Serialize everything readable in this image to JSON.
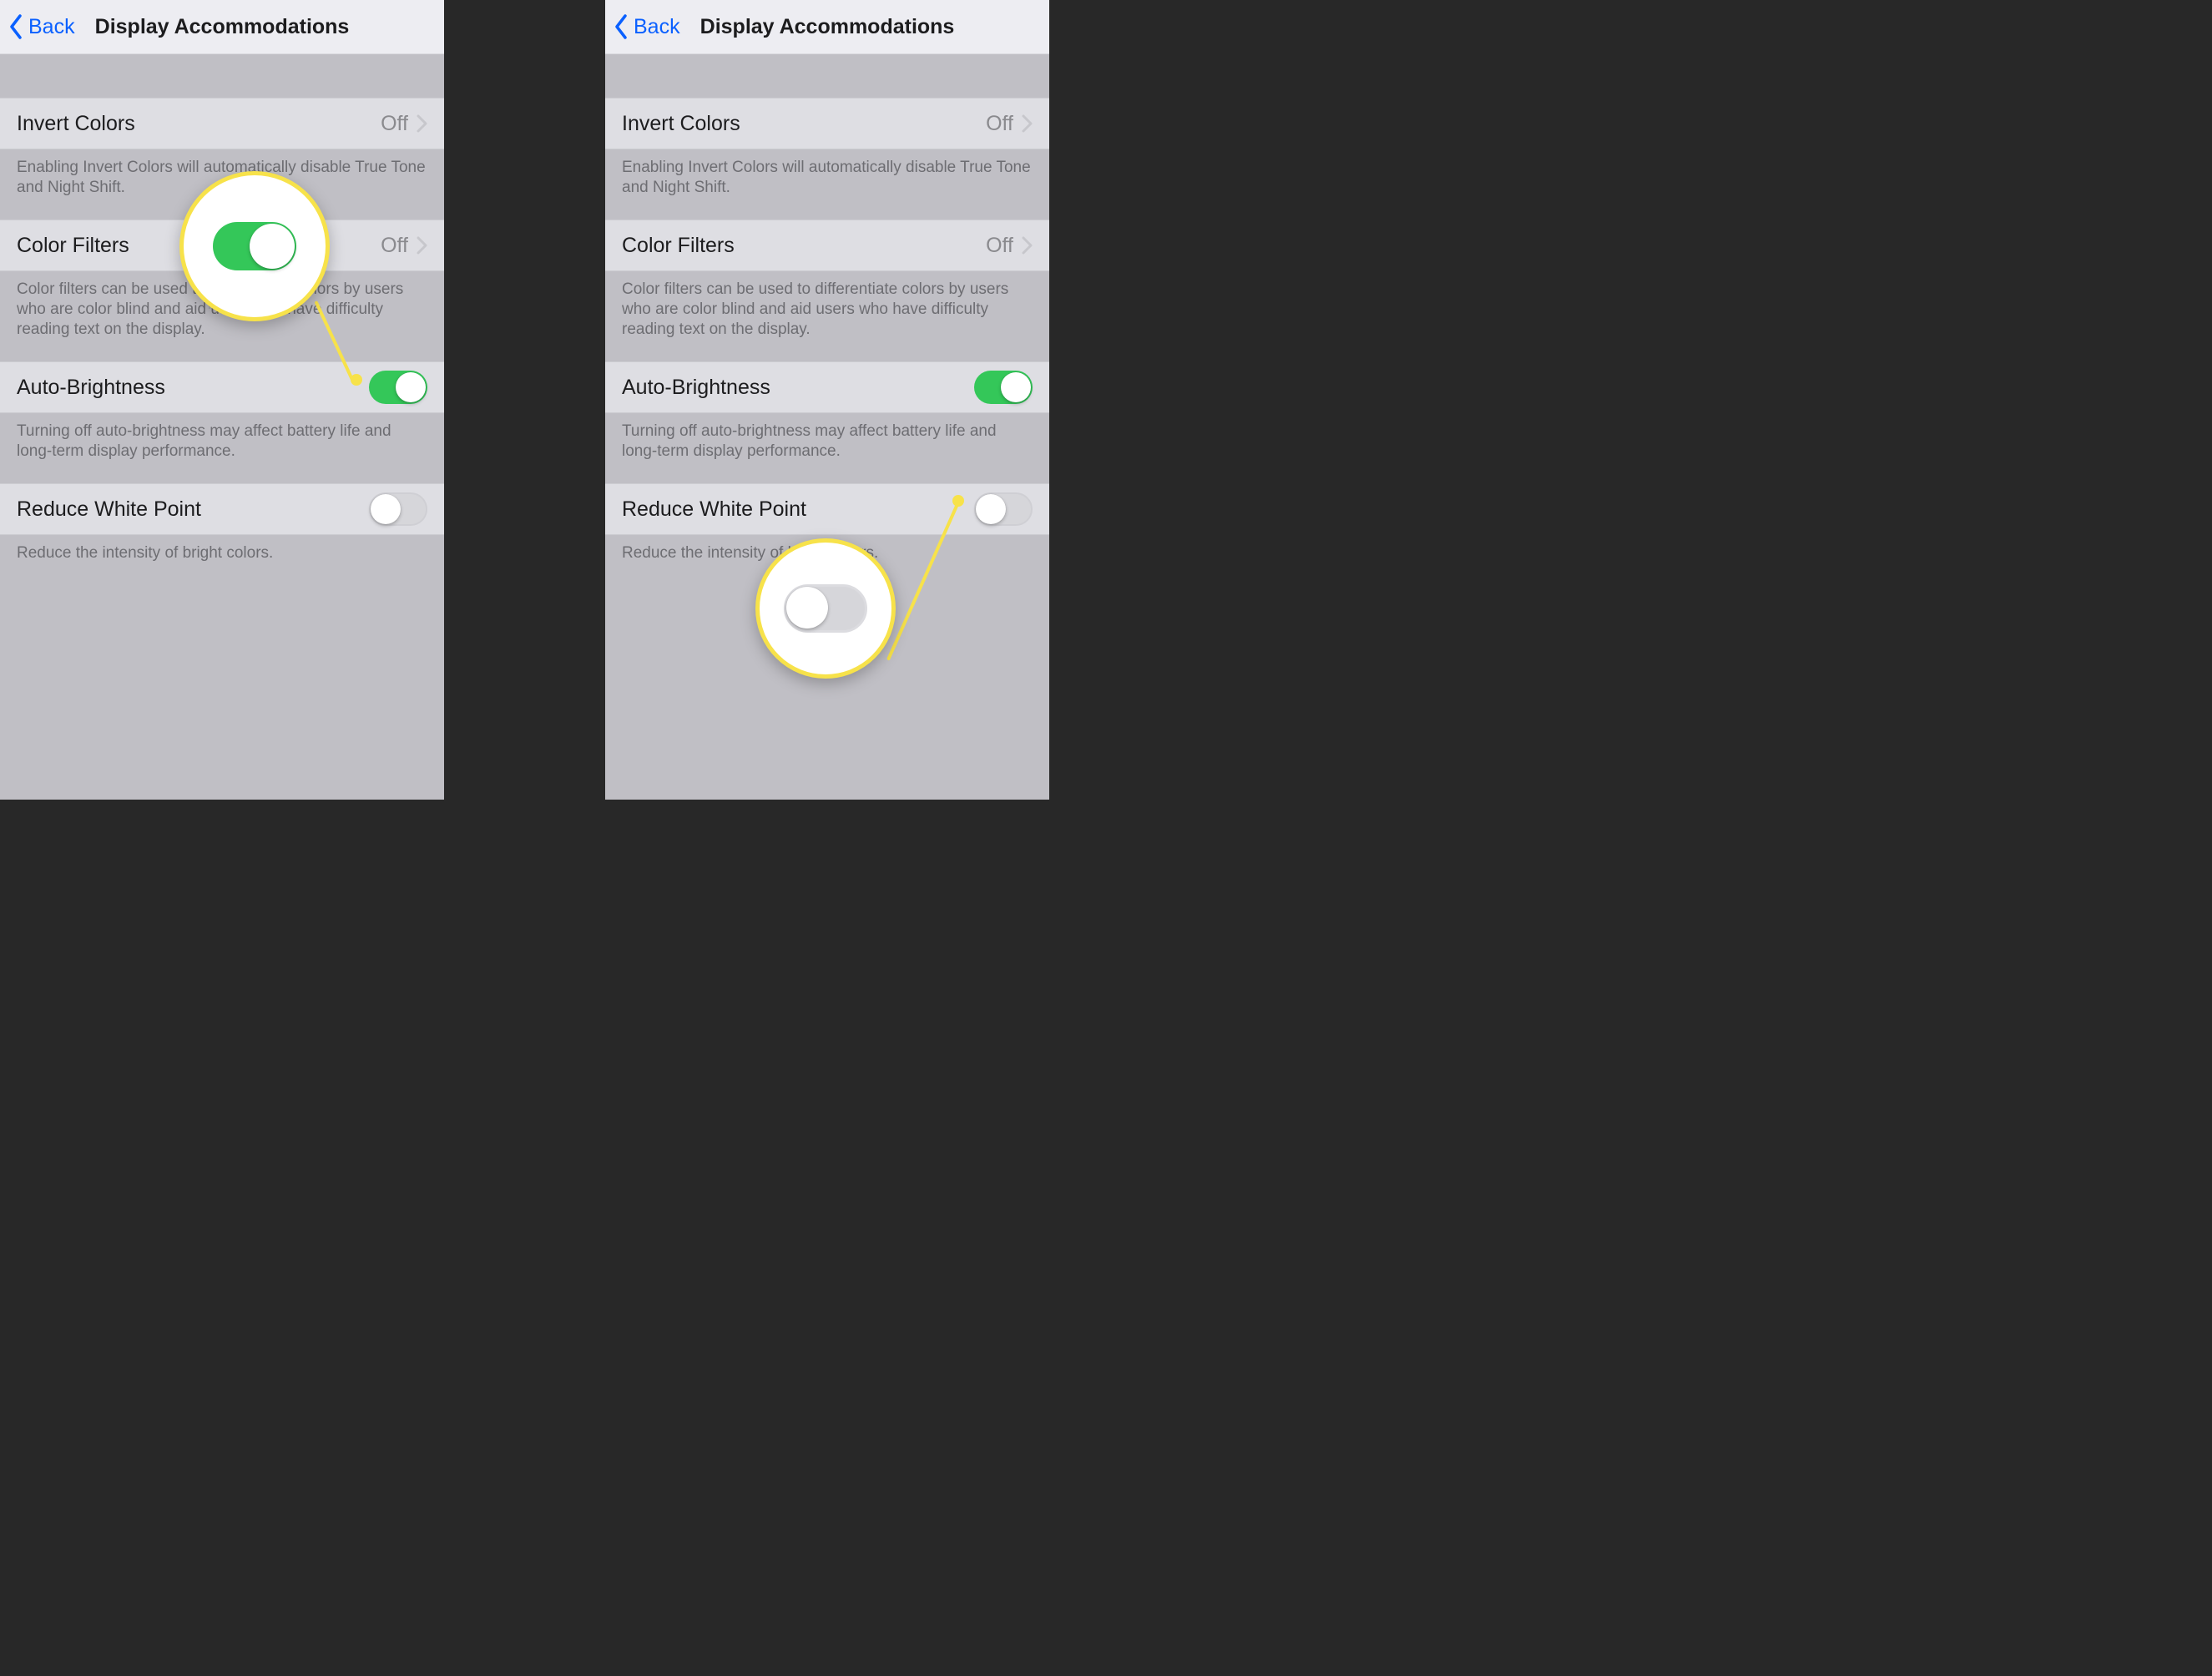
{
  "nav": {
    "back": "Back",
    "title": "Display Accommodations"
  },
  "invert": {
    "label": "Invert Colors",
    "value": "Off",
    "footer": "Enabling Invert Colors will automatically disable True Tone and Night Shift."
  },
  "filters": {
    "label": "Color Filters",
    "value": "Off",
    "footer": "Color filters can be used to differentiate colors by users who are color blind and aid users who have difficulty reading text on the display."
  },
  "autobrightness": {
    "label": "Auto-Brightness",
    "footer": "Turning off auto-brightness may affect battery life and long-term display performance."
  },
  "whitepoint": {
    "label": "Reduce White Point",
    "footer": "Reduce the intensity of bright colors."
  },
  "ghost": "nd long"
}
